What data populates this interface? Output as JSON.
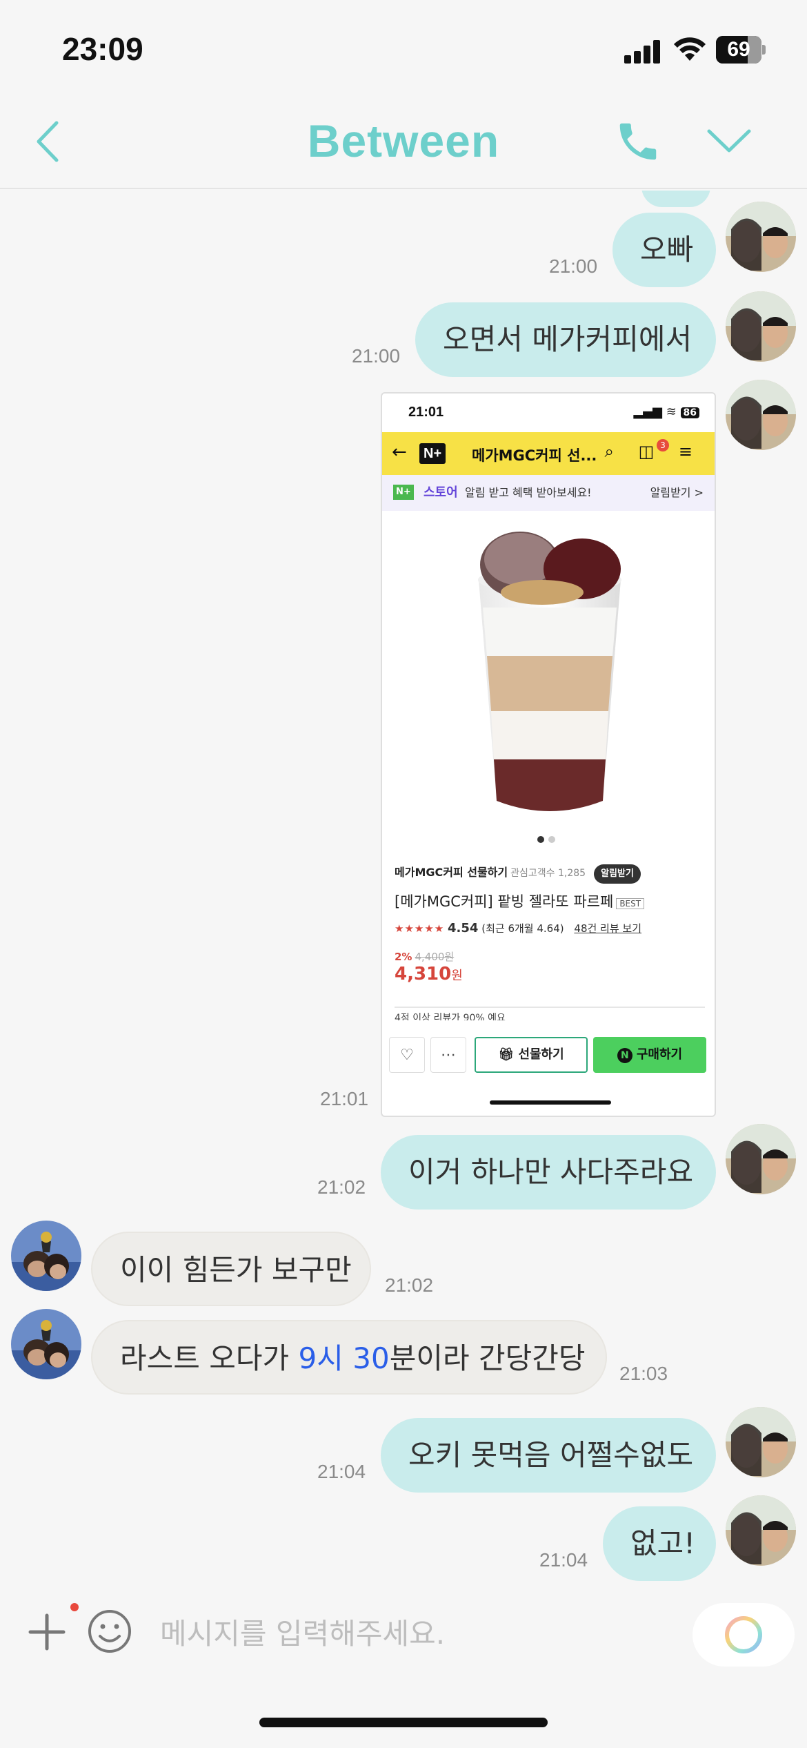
{
  "status_bar": {
    "time": "23:09",
    "battery": "69",
    "battery_level": 0.69
  },
  "header": {
    "title": "Between",
    "back_icon": "chevron-left-icon",
    "call_icon": "phone-icon",
    "menu_icon": "chevron-down-icon"
  },
  "colors": {
    "accent": "#6dcfcb",
    "my_bubble": "#c9ecec",
    "other_bubble": "#eeedea",
    "highlight_text": "#2a5ee8"
  },
  "messages": [
    {
      "sender": "me",
      "text": "오빠",
      "time": "21:00"
    },
    {
      "sender": "me",
      "text": "오면서 메가커피에서",
      "time": "21:00"
    },
    {
      "sender": "me",
      "type": "image",
      "time": "21:01"
    },
    {
      "sender": "me",
      "text": "이거 하나만 사다주라요",
      "time": "21:02"
    },
    {
      "sender": "other",
      "text": "이이 힘든가 보구만",
      "time": "21:02"
    },
    {
      "sender": "other",
      "text_before": "라스트 오다가 ",
      "text_highlight": "9시 30",
      "text_after": "분이라 간당간당",
      "time": "21:03"
    },
    {
      "sender": "me",
      "text": "오키 못먹음 어쩔수없도",
      "time": "21:04"
    },
    {
      "sender": "me",
      "text": "없고!",
      "time": "21:04"
    }
  ],
  "shared_image": {
    "status_time": "21:01",
    "battery": "86",
    "nav_title": "메가MGC커피 선...",
    "cart_count": "3",
    "banner_store": "스토어",
    "banner_text": "알림 받고 혜택 받아보세요!",
    "banner_action": "알림받기 >",
    "seller": "메가MGC커피 선물하기",
    "seller_sub": "관심고객수 1,285",
    "alarm_button": "알림받기",
    "product_name": "[메가MGC커피] 팥빙 젤라또 파르페",
    "badge": "BEST",
    "stars": "★★★★★",
    "rating": "4.54",
    "rating_recent": "(최근 6개월 4.64)",
    "reviews": "48건 리뷰 보기",
    "discount": "2%",
    "original_price": "4,400원",
    "price": "4,310",
    "price_unit": "원",
    "peek_text": "4점 이상 리뷰가 90% 예요",
    "gift_button": "선물하기",
    "buy_button": "구매하기"
  },
  "input": {
    "placeholder": "메시지를 입력해주세요."
  }
}
